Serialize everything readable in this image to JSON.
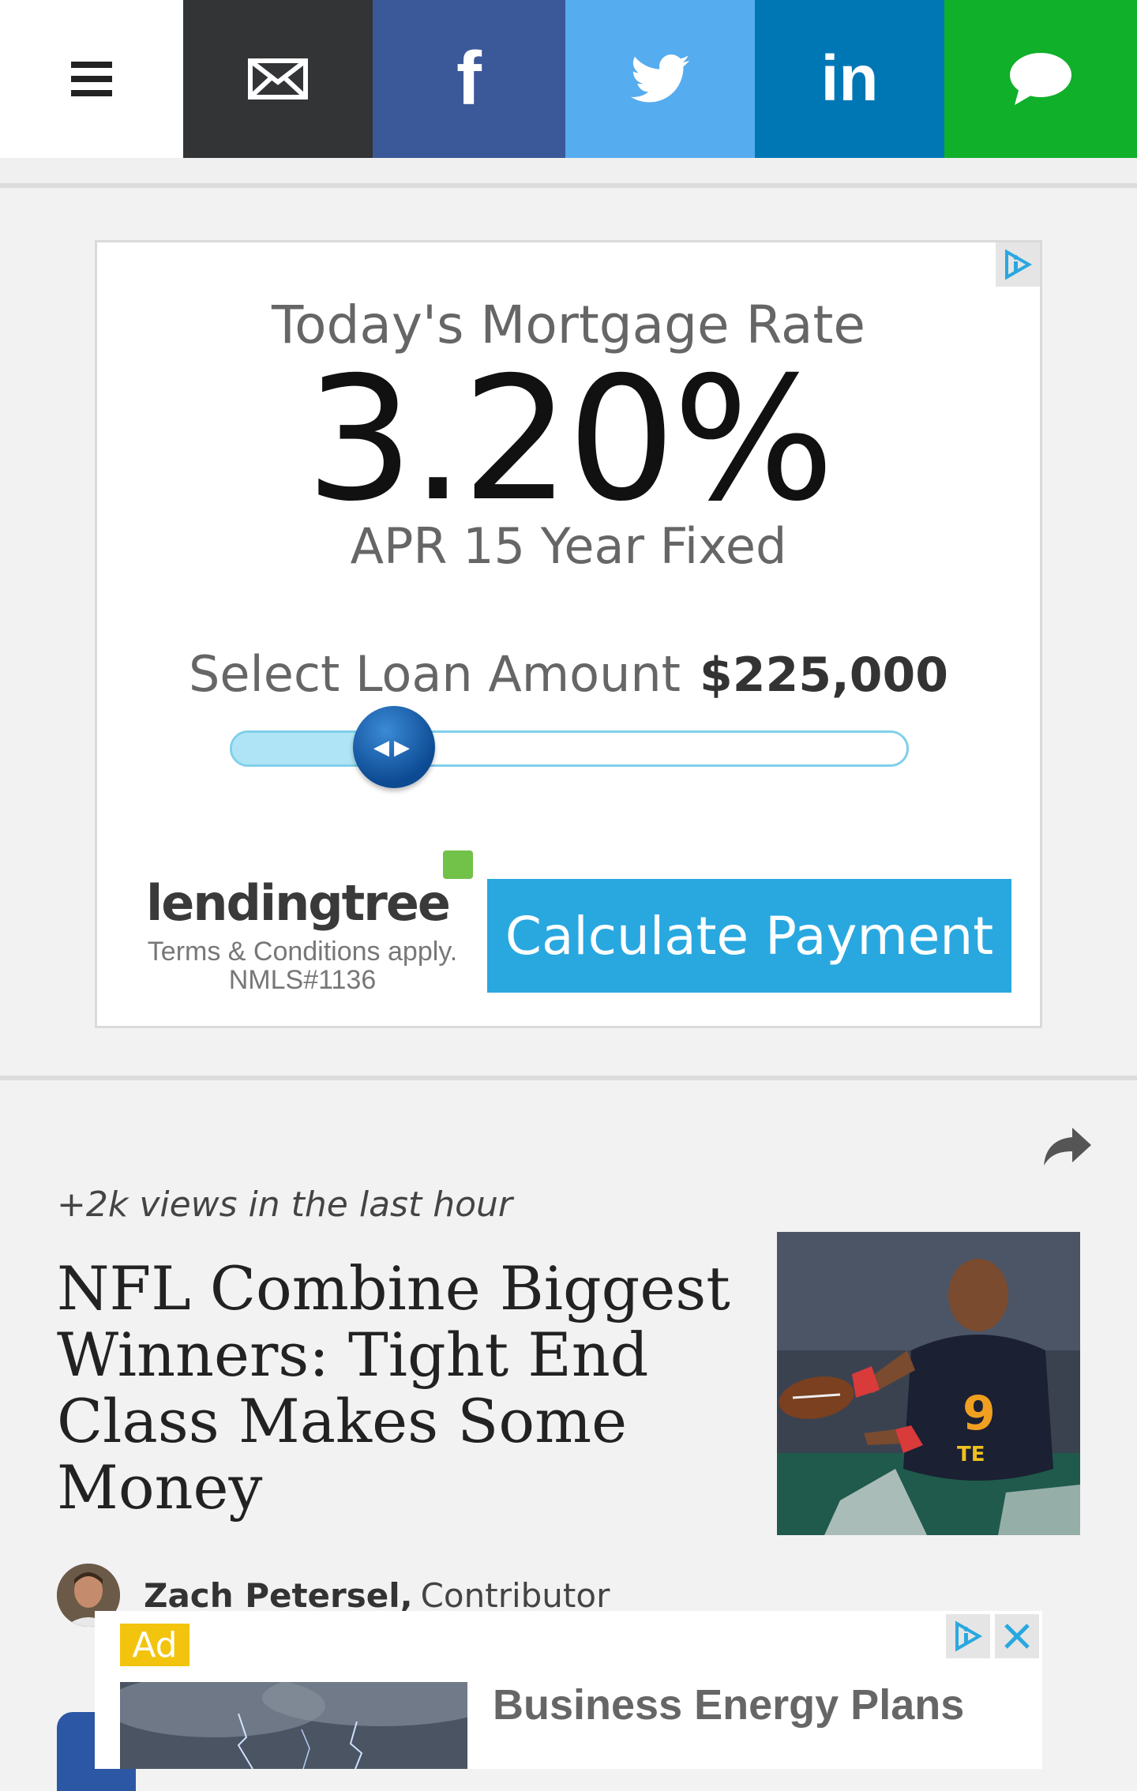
{
  "share_bar": {
    "menu_icon": "hamburger-menu-icon",
    "email_icon": "envelope-icon",
    "facebook_label": "f",
    "linkedin_label": "in",
    "twitter_icon": "twitter-bird-icon",
    "sms_icon": "speech-bubble-icon",
    "colors": {
      "email": "#333436",
      "facebook": "#3b5998",
      "twitter": "#55acee",
      "linkedin": "#0077b5",
      "sms": "#10b02a"
    }
  },
  "mortgage_ad": {
    "title": "Today's Mortgage Rate",
    "rate": "3.20%",
    "subtitle": "APR 15 Year Fixed",
    "loan_label": "Select Loan Amount",
    "loan_amount": "$225,000",
    "slider_level": 0.24,
    "brand": "lendingtree",
    "terms": "Terms & Conditions apply.",
    "nmls": "NMLS#1136",
    "cta": "Calculate Payment",
    "cta_color": "#29a8e0",
    "adchoices_icon": "adchoices-icon"
  },
  "article": {
    "views": "+2k views in the last hour",
    "headline": "NFL Combine Biggest Winners: Tight End Class Makes Some Money",
    "author_name": "Zach Petersel,",
    "author_role": "Contributor",
    "share_icon": "share-arrow-icon"
  },
  "sticky_ad": {
    "label": "Ad",
    "title": "Business Energy Plans",
    "label_color": "#f2c40d"
  }
}
